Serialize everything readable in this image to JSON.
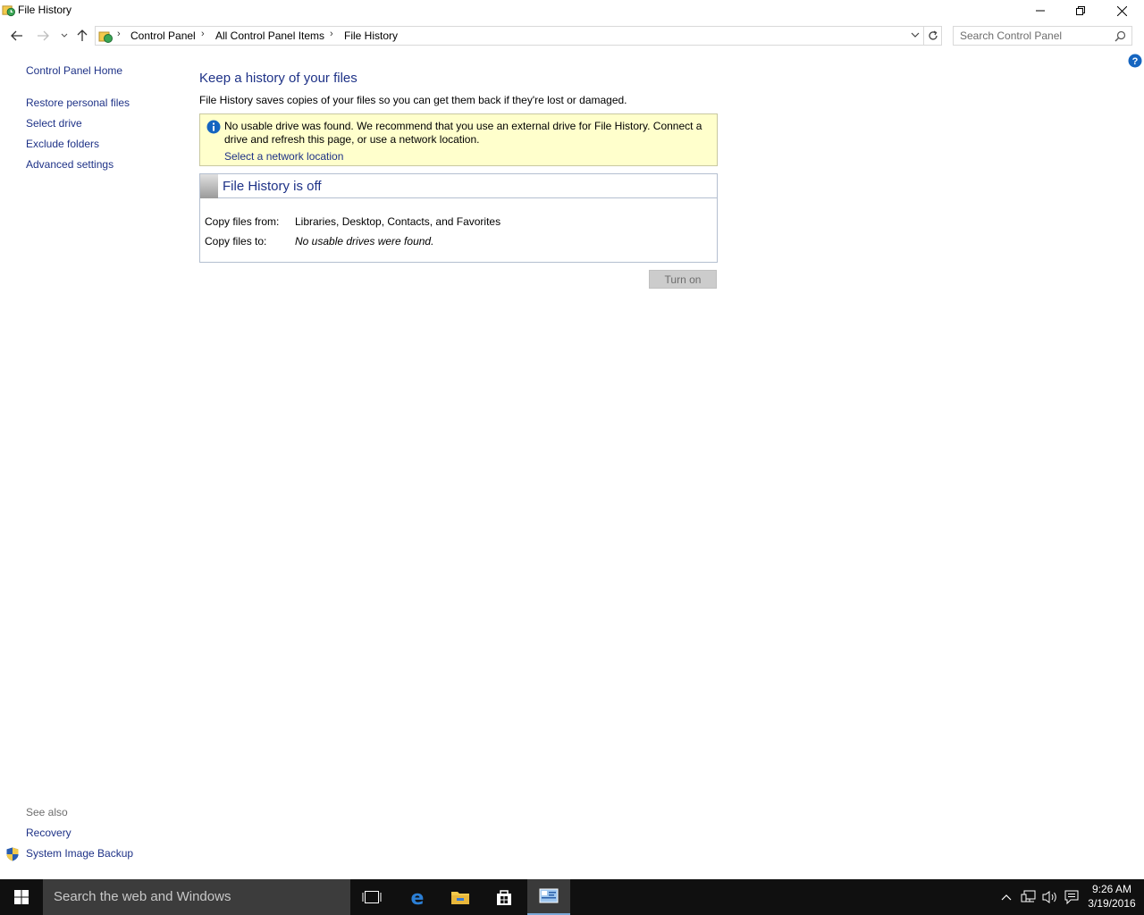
{
  "window": {
    "title": "File History"
  },
  "addressbar": {
    "crumbs": [
      "Control Panel",
      "All Control Panel Items",
      "File History"
    ],
    "search_placeholder": "Search Control Panel"
  },
  "sidebar": {
    "home": "Control Panel Home",
    "items": [
      {
        "label": "Restore personal files"
      },
      {
        "label": "Select drive"
      },
      {
        "label": "Exclude folders"
      },
      {
        "label": "Advanced settings"
      }
    ],
    "see_also_label": "See also",
    "see_also": [
      {
        "label": "Recovery"
      },
      {
        "label": "System Image Backup"
      }
    ]
  },
  "main": {
    "heading": "Keep a history of your files",
    "description": "File History saves copies of your files so you can get them back if they're lost or damaged.",
    "info": {
      "message": "No usable drive was found. We recommend that you use an external drive for File History. Connect a drive and refresh this page, or use a network location.",
      "link": "Select a network location"
    },
    "status": {
      "title": "File History is off",
      "copy_from_label": "Copy files from:",
      "copy_from_value": "Libraries, Desktop, Contacts, and Favorites",
      "copy_to_label": "Copy files to:",
      "copy_to_value": "No usable drives were found."
    },
    "turn_on_label": "Turn on"
  },
  "taskbar": {
    "search_placeholder": "Search the web and Windows",
    "apps": [
      "task-view-icon",
      "edge-icon",
      "file-explorer-icon",
      "store-icon",
      "control-panel-icon"
    ],
    "time": "9:26 AM",
    "date": "3/19/2016"
  },
  "colors": {
    "link": "#1e3287",
    "info_background": "#ffffcc",
    "taskbar": "#101010"
  }
}
